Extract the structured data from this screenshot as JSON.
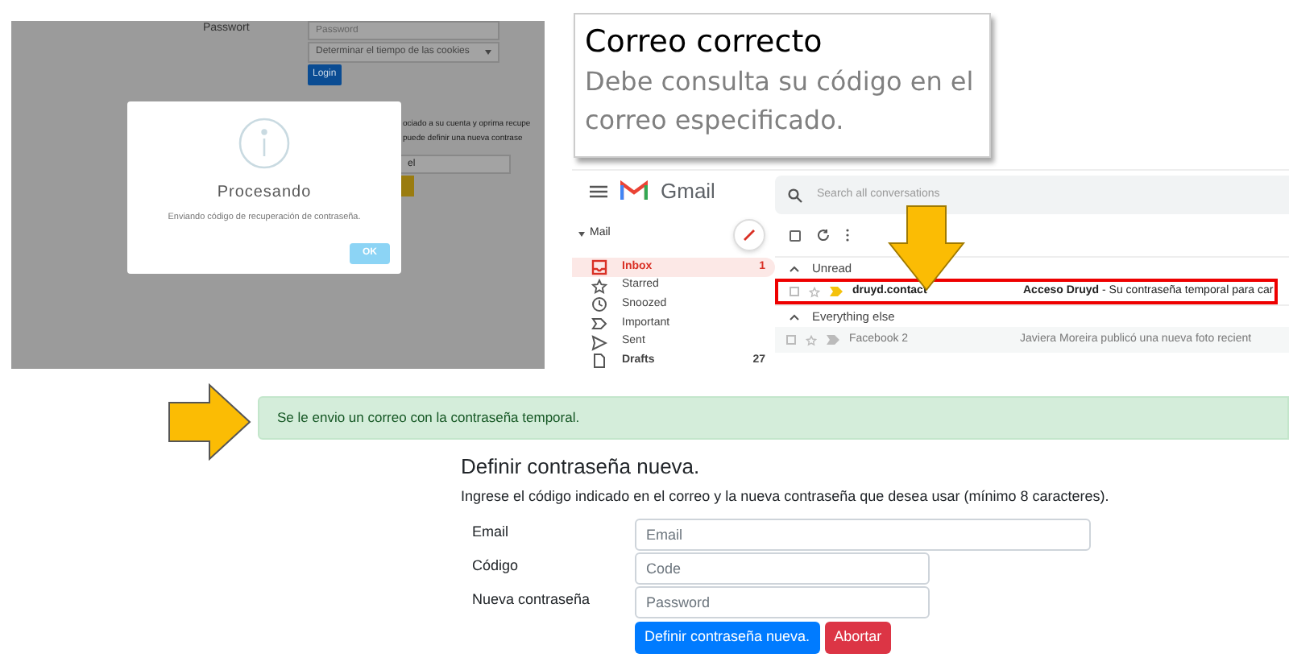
{
  "login_screen": {
    "password_label": "Passwort",
    "password_placeholder": "Password",
    "cookie_select": "Determinar el tiempo de las cookies",
    "login_button": "Login",
    "recovery_lines": [
      "ociado a su cuenta y oprima recupe",
      "puede definir una nueva contrase"
    ],
    "recovery_field": "el"
  },
  "dialog": {
    "title": "Procesando",
    "message": "Enviando código de recuperación de contraseña.",
    "button": "OK"
  },
  "callout": {
    "title": "Correo correcto",
    "text": "Debe consulta su código en el correo especificado."
  },
  "gmail": {
    "app_name": "Gmail",
    "select_all": {
      "checked": false
    },
    "search_placeholder": "Search all conversations",
    "mail_header": "Mail",
    "folders": [
      {
        "label": "Inbox",
        "count": "1",
        "selected": true,
        "unread": true
      },
      {
        "label": "Starred",
        "selected": false,
        "unread": false
      },
      {
        "label": "Snoozed",
        "selected": false,
        "unread": false
      },
      {
        "label": "Important",
        "selected": false,
        "unread": false
      },
      {
        "label": "Sent",
        "selected": false,
        "unread": false
      },
      {
        "label": "Drafts",
        "count": "27",
        "selected": false,
        "unread": true
      }
    ],
    "sections": [
      {
        "title": "Unread",
        "rows": [
          {
            "sender": "druyd.contact",
            "subject": "**Acceso Druyd** - Su contraseña temporal para car",
            "unread": true,
            "highlighted": true
          }
        ]
      },
      {
        "title": "Everything else",
        "rows": [
          {
            "sender": "Facebook 2",
            "subject": "Javiera Moreira publicó una nueva foto recient",
            "unread": false,
            "highlighted": false
          }
        ]
      }
    ]
  },
  "alert": {
    "text": "Se le envio un correo con la contraseña temporal."
  },
  "form": {
    "title": "Definir contraseña nueva.",
    "description": "Ingrese el código indicado en el correo y la nueva contraseña que desea usar (mínimo 8 caracteres).",
    "fields": [
      {
        "label": "Email",
        "placeholder": "Email",
        "wide": true
      },
      {
        "label": "Código",
        "placeholder": "Code",
        "wide": false
      },
      {
        "label": "Nueva contraseña",
        "placeholder": "Password",
        "wide": false
      }
    ],
    "buttons": [
      {
        "label": "Definir contraseña nueva.",
        "kind": "primary"
      },
      {
        "label": "Abortar",
        "kind": "danger"
      }
    ]
  }
}
